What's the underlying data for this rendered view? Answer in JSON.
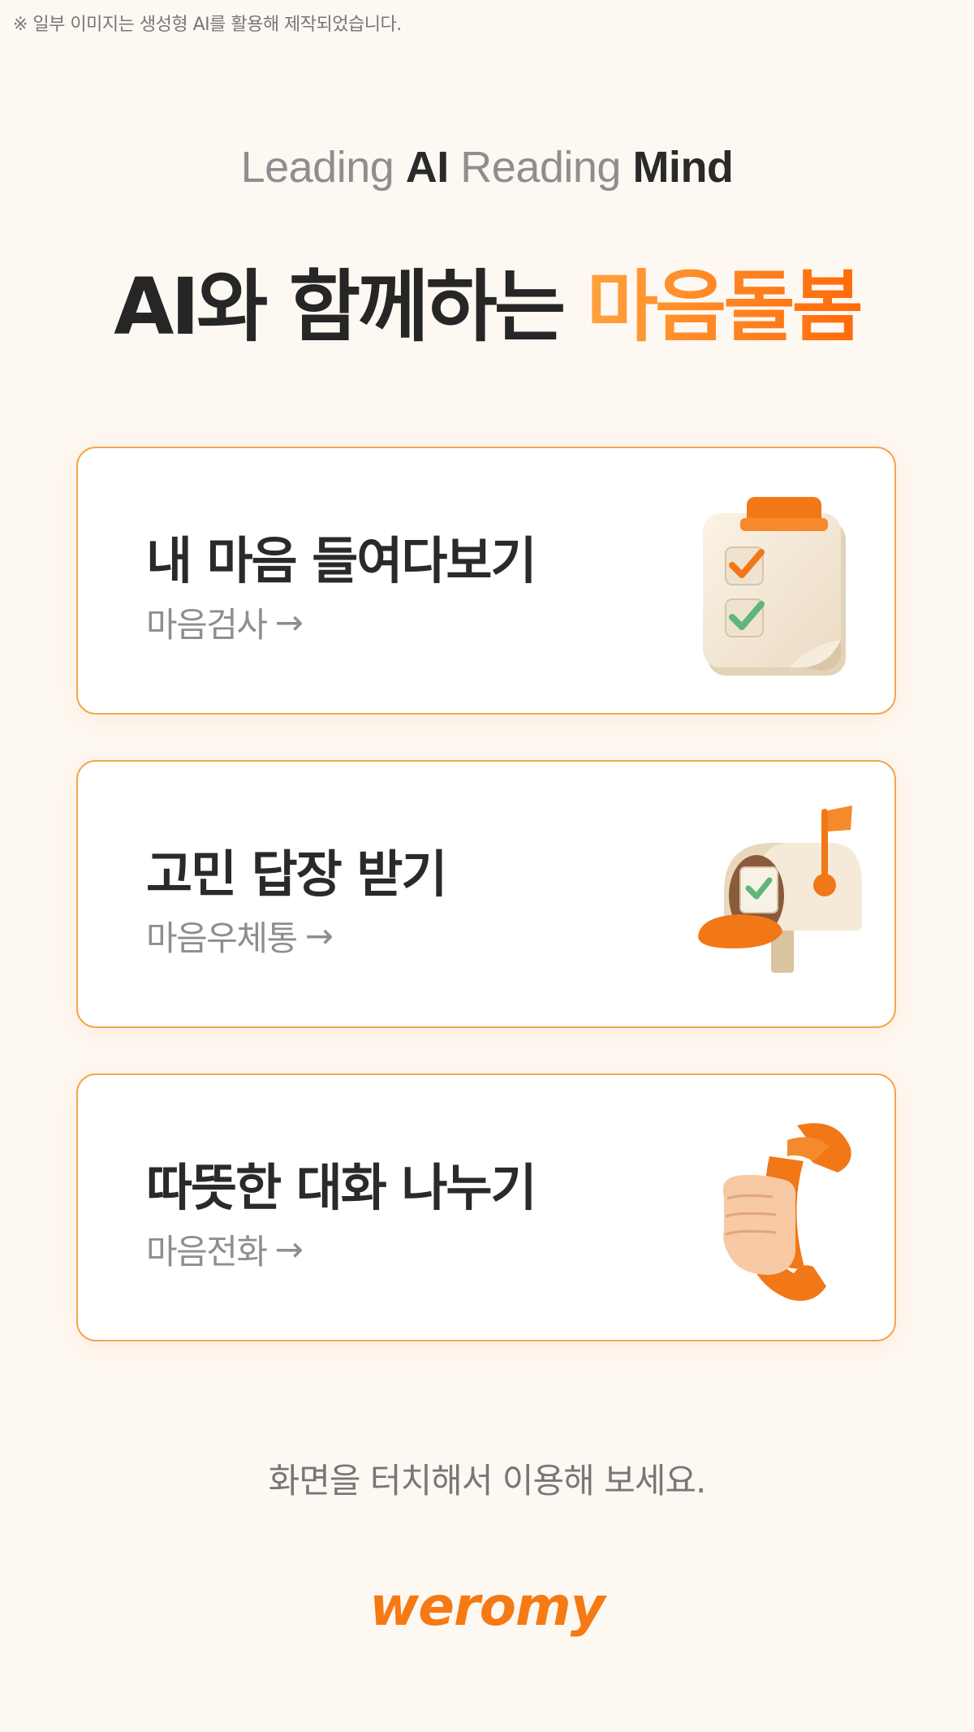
{
  "disclaimer": "※ 일부 이미지는 생성형 AI를 활용해 제작되었습니다.",
  "tagline": {
    "part1": "Leading ",
    "part2": "AI",
    "part3": " Reading ",
    "part4": "Mind"
  },
  "headline": {
    "main": "AI와 함께하는 ",
    "accent": "마음돌봄"
  },
  "cards": [
    {
      "title": "내 마음 들여다보기",
      "sub": "마음검사",
      "icon": "checklist-clipboard-icon"
    },
    {
      "title": "고민 답장 받기",
      "sub": "마음우체통",
      "icon": "mailbox-icon"
    },
    {
      "title": "따뜻한 대화 나누기",
      "sub": "마음전화",
      "icon": "phone-in-hand-icon"
    }
  ],
  "arrow": "→",
  "hint": "화면을 터치해서 이용해 보세요.",
  "logo": "weromy",
  "colors": {
    "accent": "#f57a14",
    "accent_light": "#ffa23d",
    "border": "#f5a54f",
    "background": "#fef8f2"
  }
}
